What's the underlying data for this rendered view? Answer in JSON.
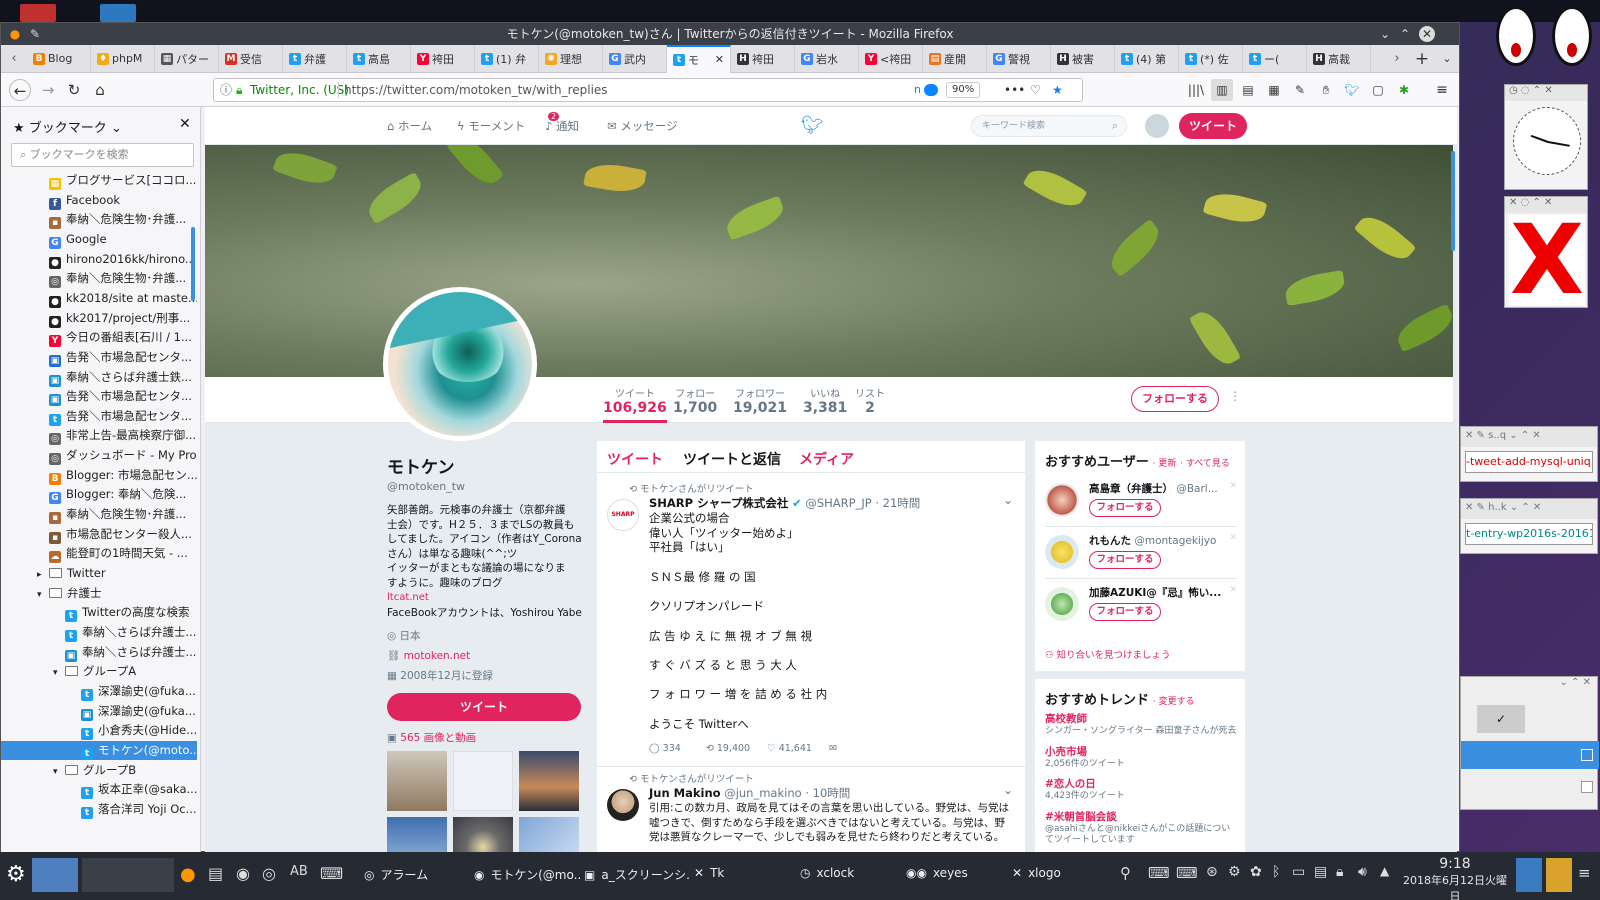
{
  "window": {
    "title": "モトケン(@motoken_tw)さん | Twitterからの返信付きツイート - Mozilla Firefox"
  },
  "tabs": [
    {
      "label": "Blog",
      "icon": "blogger",
      "color": "#f57d00"
    },
    {
      "label": "phpM",
      "icon": "phpmyadmin",
      "color": "#f2a91c"
    },
    {
      "label": "パター",
      "icon": "grid",
      "color": "#555555"
    },
    {
      "label": "受信",
      "icon": "gmail",
      "color": "#d93025"
    },
    {
      "label": "弁護",
      "icon": "twitter",
      "color": "#1da1f2"
    },
    {
      "label": "高島",
      "icon": "twitter",
      "color": "#1da1f2"
    },
    {
      "label": "袴田",
      "icon": "yahoo",
      "color": "#ff0033"
    },
    {
      "label": "(1) 弁",
      "icon": "twitter",
      "color": "#1da1f2"
    },
    {
      "label": "理想",
      "icon": "sun",
      "color": "#f5a623"
    },
    {
      "label": "武内",
      "icon": "google",
      "color": "#4285f4"
    },
    {
      "label": "モ",
      "icon": "twitter",
      "color": "#1da1f2",
      "active": true
    },
    {
      "label": "袴田",
      "icon": "hatena",
      "color": "#333333"
    },
    {
      "label": "岩水",
      "icon": "google",
      "color": "#4285f4"
    },
    {
      "label": "<袴田",
      "icon": "yahoo",
      "color": "#ff0033"
    },
    {
      "label": "産開",
      "icon": "note",
      "color": "#e87722"
    },
    {
      "label": "警視",
      "icon": "google",
      "color": "#4285f4"
    },
    {
      "label": "被害",
      "icon": "hatena",
      "color": "#333333"
    },
    {
      "label": "(4) 第",
      "icon": "twitter",
      "color": "#1da1f2"
    },
    {
      "label": "(*) 佐",
      "icon": "twitter",
      "color": "#1da1f2"
    },
    {
      "label": "ー(",
      "icon": "twitter",
      "color": "#1da1f2"
    },
    {
      "label": "高裁",
      "icon": "hatena",
      "color": "#333333"
    }
  ],
  "navbar": {
    "site_identity": "Twitter, Inc. (US)",
    "url": "https://twitter.com/motoken_tw/with_replies",
    "zoom": "90%",
    "ext_label": "n"
  },
  "sidebar": {
    "title": "ブックマーク",
    "search_placeholder": "ブックマークを検索",
    "items": [
      {
        "label": "ブログサービス[ココロ...",
        "icon": "grid",
        "color": "#f2c200",
        "indent": 0
      },
      {
        "label": "Facebook",
        "icon": "facebook",
        "color": "#3b5998",
        "indent": 0
      },
      {
        "label": "奉納＼危険生物･弁護...",
        "icon": "image",
        "color": "#a86a3b",
        "indent": 0
      },
      {
        "label": "Google",
        "icon": "google",
        "color": "#4285f4",
        "indent": 0
      },
      {
        "label": "hirono2016kk/hirono...",
        "icon": "github",
        "color": "#222222",
        "indent": 0
      },
      {
        "label": "奉納＼危険生物･弁護...",
        "icon": "globe",
        "color": "#666666",
        "indent": 0
      },
      {
        "label": "kk2018/site at maste...",
        "icon": "github",
        "color": "#222222",
        "indent": 0
      },
      {
        "label": "kk2017/project/刑事...",
        "icon": "github",
        "color": "#222222",
        "indent": 0
      },
      {
        "label": "今日の番組表[石川 / 1...",
        "icon": "yahoo",
        "color": "#ff0033",
        "indent": 0
      },
      {
        "label": "告発＼市場急配センタ...",
        "icon": "doc",
        "color": "#1e6fd0",
        "indent": 0
      },
      {
        "label": "奉納＼さらば弁護士鉄...",
        "icon": "doc",
        "color": "#1e90d0",
        "indent": 0
      },
      {
        "label": "告発＼市場急配センタ...",
        "icon": "doc",
        "color": "#1e90d0",
        "indent": 0
      },
      {
        "label": "告発＼市場急配センタ...",
        "icon": "twitter",
        "color": "#1da1f2",
        "indent": 0
      },
      {
        "label": "非常上告-最高検察庁御...",
        "icon": "globe",
        "color": "#666666",
        "indent": 0
      },
      {
        "label": "ダッシュボード - My Pro...",
        "icon": "globe",
        "color": "#666666",
        "indent": 0
      },
      {
        "label": "Blogger: 市場急配セン...",
        "icon": "blogger",
        "color": "#f57d00",
        "indent": 0
      },
      {
        "label": "Blogger: 奉納＼危険...",
        "icon": "google",
        "color": "#4285f4",
        "indent": 0
      },
      {
        "label": "奉納＼危険生物･弁護...",
        "icon": "image",
        "color": "#a86a3b",
        "indent": 0
      },
      {
        "label": "市場急配センター殺人...",
        "icon": "image",
        "color": "#7d5a3b",
        "indent": 0
      },
      {
        "label": "能登町の1時間天気 - ...",
        "icon": "weather",
        "color": "#b86b2b",
        "indent": 0
      },
      {
        "label": "Twitter",
        "icon": "folder",
        "indent": 0,
        "expand": "▸"
      },
      {
        "label": "弁護士",
        "icon": "folder",
        "indent": 0,
        "expand": "▾"
      },
      {
        "label": "Twitterの高度な検索",
        "icon": "twitter",
        "color": "#1da1f2",
        "indent": 1
      },
      {
        "label": "奉納＼さらば弁護士...",
        "icon": "twitter",
        "color": "#1da1f2",
        "indent": 1
      },
      {
        "label": "奉納＼さらば弁護士...",
        "icon": "doc",
        "color": "#1e90d0",
        "indent": 1
      },
      {
        "label": "グループA",
        "icon": "folder",
        "indent": 1,
        "expand": "▾"
      },
      {
        "label": "深澤諭史(@fuka...",
        "icon": "twitter",
        "color": "#1da1f2",
        "indent": 2
      },
      {
        "label": "深澤諭史(@fuka...",
        "icon": "doc",
        "color": "#1e90d0",
        "indent": 2
      },
      {
        "label": "小倉秀夫(@Hide...",
        "icon": "twitter",
        "color": "#1da1f2",
        "indent": 2
      },
      {
        "label": "モトケン(@moto...",
        "icon": "twitter",
        "color": "#1da1f2",
        "indent": 2,
        "selected": true
      },
      {
        "label": "グループB",
        "icon": "folder",
        "indent": 1,
        "expand": "▾"
      },
      {
        "label": "坂本正幸(@saka...",
        "icon": "twitter",
        "color": "#1da1f2",
        "indent": 2
      },
      {
        "label": "落合洋司 Yoji Oc...",
        "icon": "twitter",
        "color": "#1da1f2",
        "indent": 2
      }
    ]
  },
  "twitter_nav": {
    "home": "ホーム",
    "moments": "モーメント",
    "notifications": "通知",
    "notifications_badge": "2",
    "messages": "メッセージ",
    "search_placeholder": "キーワード検索",
    "tweet_button": "ツイート"
  },
  "profile": {
    "name": "モトケン",
    "handle": "@motoken_tw",
    "bio": [
      "矢部善朗。元検事の弁護士（京都弁護",
      "士会）です。H２５．３までLSの教員も",
      "してました。アイコン（作者はY_Coronaさん）は単なる趣味(^^;ツ",
      "イッターがまともな議論の場になりま",
      "すように。趣味のブログ"
    ],
    "bio_link": "ltcat.net",
    "bio_tail": "FaceBookアカウントは、Yoshirou Yabe",
    "location": "日本",
    "website": "motoken.net",
    "joined": "2008年12月に登録",
    "tweet_button": "ツイート",
    "media_link": "565 画像と動画",
    "follow_button": "フォローする",
    "stats": [
      {
        "label": "ツイート",
        "value": "106,926",
        "active": true
      },
      {
        "label": "フォロー",
        "value": "1,700"
      },
      {
        "label": "フォロワー",
        "value": "19,021"
      },
      {
        "label": "いいね",
        "value": "3,381"
      },
      {
        "label": "リスト",
        "value": "2"
      }
    ]
  },
  "timeline": {
    "tabs": [
      "ツイート",
      "ツイートと返信",
      "メディア"
    ],
    "tweets": [
      {
        "retweet_note": "モトケンさんがリツイート",
        "author": "SHARP シャープ株式会社",
        "handle": "@SHARP_JP",
        "time": "21時間",
        "lines": [
          "企業公式の場合",
          "偉い人「ツイッター始めよ」",
          "平社員「はい」",
          "",
          "ＳＮＳ最 修 羅 の 国",
          "",
          "クソリプオンパレード",
          "",
          "広 告 ゆ え に 無 視 オ ブ 無 視",
          "",
          "す ぐ バ ズ る と 思 う 大 人",
          "",
          "フ ォ ロ ワ ー 増 を 詰 め る 社 内",
          "",
          "ようこそ Twitterへ"
        ],
        "replies": "334",
        "retweets": "19,400",
        "likes": "41,641"
      },
      {
        "retweet_note": "モトケンさんがリツイート",
        "author": "Jun Makino",
        "handle": "@jun_makino",
        "time": "10時間",
        "lines": [
          "引用:この数カ月、政局を見てはその言葉を思い出している。野党は、与党は",
          "嘘つきで、倒すためなら手段を選ぶべきではないと考えている。与党は、野",
          "党は悪質なクレーマーで、少しでも弱みを見せたら終わりだと考えている。"
        ]
      }
    ]
  },
  "who_to_follow": {
    "title": "おすすめユーザー",
    "refresh": "更新",
    "view_all": "すべて見る",
    "follow_label": "フォローする",
    "find_friends": "知り合いを見つけましょう",
    "users": [
      {
        "name": "高島章（弁護士）",
        "handle": "@Barl..."
      },
      {
        "name": "れもんた",
        "handle": "@montagekijyo"
      },
      {
        "name": "加藤AZUKI@『忌』怖い...",
        "handle": ""
      }
    ]
  },
  "trends": {
    "title": "おすすめトレンド",
    "change": "変更する",
    "items": [
      {
        "name": "高校教師",
        "desc": "シンガー・ソングライター 森田童子さんが死去"
      },
      {
        "name": "小売市場",
        "desc": "2,056件のツイート"
      },
      {
        "name": "#恋人の日",
        "desc": "4,423件のツイート"
      },
      {
        "name": "#米朝首脳会談",
        "desc": "@asahiさんと@nikkeiさんがこの話題についてツイートしています"
      }
    ]
  },
  "side_windows": {
    "tab1": "s..q",
    "field1": "-tweet-add-mysql-uniq.r",
    "tab2": "h..k",
    "field2": "t-entry-wp2016s-20161"
  },
  "taskbar": {
    "items": [
      "アラーム",
      "モトケン(@mo...",
      "a_スクリーンシ...",
      "Tk",
      "xclock",
      "xeyes",
      "xlogo"
    ],
    "time": "9:18",
    "date": "2018年6月12日火曜日"
  }
}
